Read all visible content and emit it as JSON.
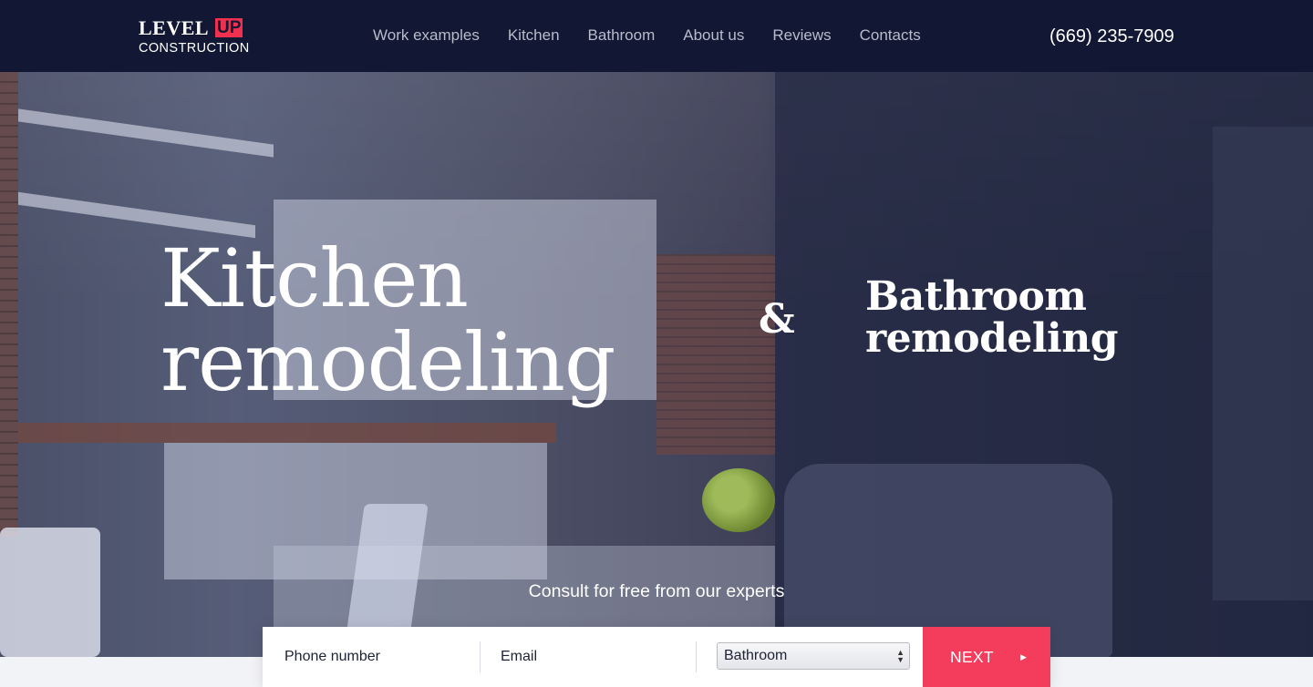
{
  "header": {
    "logo": {
      "word1": "LEVEL",
      "word2": "UP",
      "subtitle": "CONSTRUCTION"
    },
    "nav": [
      "Work examples",
      "Kitchen",
      "Bathroom",
      "About us",
      "Reviews",
      "Contacts"
    ],
    "phone": "(669) 235-7909"
  },
  "hero": {
    "kitchen_line1": "Kitchen",
    "kitchen_line2": "remodeling",
    "ampersand": "&",
    "bathroom_line1": "Bathroom",
    "bathroom_line2": "remodeling",
    "consult_text": "Consult for free from our experts"
  },
  "form": {
    "phone_placeholder": "Phone number",
    "email_placeholder": "Email",
    "service_selected": "Bathroom",
    "next_label": "NEXT"
  },
  "colors": {
    "header_bg": "#121833",
    "accent": "#f43d5d",
    "nav_text": "#b7bbcb"
  }
}
